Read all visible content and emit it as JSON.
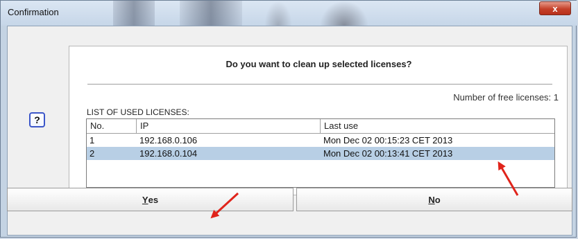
{
  "window": {
    "title": "Confirmation",
    "close_label": "x"
  },
  "dialog": {
    "icon_label": "?",
    "question": "Do you want to clean up selected licenses?",
    "free_licenses": "Number of free licenses: 1",
    "list_title": "LIST OF USED LICENSES:"
  },
  "table": {
    "columns": [
      "No.",
      "IP",
      "Last use"
    ],
    "rows": [
      {
        "no": "1",
        "ip": "192.168.0.106",
        "last_use": "Mon Dec 02 00:15:23 CET 2013",
        "selected": false
      },
      {
        "no": "2",
        "ip": "192.168.0.104",
        "last_use": "Mon Dec 02 00:13:41 CET 2013",
        "selected": true
      }
    ]
  },
  "buttons": {
    "yes_mnemonic": "Y",
    "yes_rest": "es",
    "no_mnemonic": "N",
    "no_rest": "o"
  },
  "colors": {
    "selection": "#b8cfe5",
    "annotation_arrow": "#e0241b",
    "close_button": "#c5412a"
  }
}
